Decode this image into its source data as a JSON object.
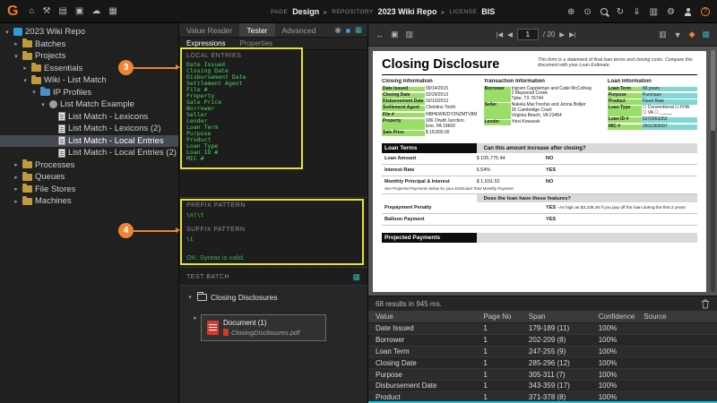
{
  "glyphs": {
    "chevron_down": "▾",
    "chevron_right": "▸",
    "separator": "▸"
  },
  "topbar": {
    "logo_text": "G",
    "left_icons": [
      {
        "name": "home-icon",
        "glyph": "⌂"
      },
      {
        "name": "tools-icon",
        "glyph": "⚒"
      },
      {
        "name": "batches-icon",
        "glyph": "▤"
      },
      {
        "name": "camera-icon",
        "glyph": "▣"
      },
      {
        "name": "clouds-icon",
        "glyph": "☁"
      },
      {
        "name": "stats-icon",
        "glyph": "▦"
      }
    ],
    "breadcrumb": {
      "page_label": "PAGE",
      "page_value": "Design",
      "repo_label": "REPOSITORY",
      "repo_value": "2023 Wiki Repo",
      "license_label": "LICENSE",
      "license_value": "BIS"
    },
    "right_icons": [
      {
        "name": "add-circle-icon",
        "glyph": "⊕"
      },
      {
        "name": "target-circle-icon",
        "glyph": "⊙"
      },
      {
        "name": "search-icon",
        "glyph": ""
      },
      {
        "name": "refresh-icon",
        "glyph": "↻"
      },
      {
        "name": "download-icon",
        "glyph": "⇓"
      },
      {
        "name": "columns-icon",
        "glyph": "▥"
      },
      {
        "name": "gear-icon",
        "glyph": "⚙"
      },
      {
        "name": "user-icon",
        "glyph": ""
      },
      {
        "name": "help-icon",
        "glyph": "?"
      }
    ]
  },
  "tree": {
    "items": [
      {
        "label": "2023 Wiki Repo",
        "level": 0,
        "arrow": "down",
        "icon": "repo"
      },
      {
        "label": "Batches",
        "level": 1,
        "arrow": "right",
        "icon": "folder"
      },
      {
        "label": "Projects",
        "level": 1,
        "arrow": "down",
        "icon": "folder"
      },
      {
        "label": "Essentials",
        "level": 2,
        "arrow": "right",
        "icon": "folder"
      },
      {
        "label": "Wiki - List Match",
        "level": 2,
        "arrow": "down",
        "icon": "folder"
      },
      {
        "label": "IP Profiles",
        "level": 3,
        "arrow": "down",
        "icon": "folder-blue"
      },
      {
        "label": "List Match Example",
        "level": 4,
        "arrow": "down",
        "icon": "gear"
      },
      {
        "label": "List Match - Lexicons",
        "level": 5,
        "arrow": null,
        "icon": "doc"
      },
      {
        "label": "List Match - Lexicons (2)",
        "level": 5,
        "arrow": null,
        "icon": "doc"
      },
      {
        "label": "List Match - Local Entries",
        "level": 5,
        "arrow": null,
        "icon": "doc",
        "selected": true
      },
      {
        "label": "List Match - Local Entries (2)",
        "level": 5,
        "arrow": null,
        "icon": "doc"
      },
      {
        "label": "Processes",
        "level": 1,
        "arrow": "right",
        "icon": "folder"
      },
      {
        "label": "Queues",
        "level": 1,
        "arrow": "right",
        "icon": "folder"
      },
      {
        "label": "File Stores",
        "level": 1,
        "arrow": "right",
        "icon": "folder"
      },
      {
        "label": "Machines",
        "level": 1,
        "arrow": "right",
        "icon": "folder"
      }
    ]
  },
  "middle": {
    "tabs": [
      {
        "label": "Value Reader",
        "active": false
      },
      {
        "label": "Tester",
        "active": true
      },
      {
        "label": "Advanced",
        "active": false
      }
    ],
    "tab_icons": [
      {
        "name": "eye-icon",
        "glyph": "◉"
      },
      {
        "name": "blue-panel-icon",
        "glyph": "■"
      },
      {
        "name": "grid-icon",
        "glyph": "▦"
      }
    ],
    "subtabs": [
      {
        "label": "Expressions",
        "active": true
      },
      {
        "label": "Properties",
        "active": false
      }
    ],
    "local_entries_label": "LOCAL ENTRIES",
    "entries": [
      "Date Issued",
      "Closing Date",
      "Disbursement Date",
      "Settlement Agent",
      "File #",
      "Property",
      "Sale Price",
      "Borrower",
      "Seller",
      "Lender",
      "Loan Term",
      "Purpose",
      "Product",
      "Loan Type",
      "Loan ID #",
      "MIC #"
    ],
    "prefix_label": "PREFIX PATTERN",
    "prefix_value": "\\n|\\t",
    "suffix_label": "SUFFIX PATTERN",
    "suffix_value": "\\t",
    "syntax_status": "OK: Syntax is valid.",
    "test_batch": {
      "header": "TEST BATCH",
      "folder_label": "Closing Disclosures",
      "document_label": "Document (1)",
      "file_name": "ClosingDisclosures.pdf"
    }
  },
  "callouts": [
    {
      "number": "3"
    },
    {
      "number": "4"
    }
  ],
  "viewer": {
    "left_icons": [
      {
        "name": "fit-width-icon",
        "glyph": "↔"
      },
      {
        "name": "pages-icon",
        "glyph": "▣"
      },
      {
        "name": "thumbnails-icon",
        "glyph": "▥"
      }
    ],
    "nav": {
      "first": "|◀",
      "prev": "◀",
      "page": "1",
      "total": "/ 20",
      "next": "▶",
      "last": "▶|"
    },
    "right_icons": [
      {
        "name": "layout-icon",
        "glyph": "▥"
      },
      {
        "name": "dropdown-icon",
        "glyph": "▼"
      },
      {
        "name": "highlight-icon",
        "glyph": "◆"
      },
      {
        "name": "grid-teal-icon",
        "glyph": "▦"
      }
    ]
  },
  "document": {
    "title": "Closing Disclosure",
    "intro": "This form is a statement of final loan terms and closing costs. Compare this document with your Loan Estimate.",
    "columns": [
      {
        "header": "Closing Information",
        "fields": [
          {
            "label": "Date Issued",
            "value": "09/14/2015",
            "label_hl": "green"
          },
          {
            "label": "Closing Date",
            "value": "02/29/2013",
            "label_hl": "green"
          },
          {
            "label": "Disbursement Date",
            "value": "02/10/2013",
            "label_hl": "green"
          },
          {
            "label": "Settlement Agent",
            "value": "Christine Tooth",
            "label_hl": "green"
          },
          {
            "label": "File #",
            "value": "NBHKWR/DY2NZMTV8M2",
            "label_hl": "green"
          },
          {
            "label": "Property",
            "value": "936 Orwitt Junction\nErie, PA 18600",
            "label_hl": "green"
          },
          {
            "label": "Sale Price",
            "value": "$ 18,800.00",
            "label_hl": "green"
          }
        ]
      },
      {
        "header": "Transaction Information",
        "fields": [
          {
            "label": "Borrower",
            "value": "Ingram Cappleman and Catie McCollvay\n2 Maywood Creek\nTpke, TX 76744",
            "label_hl": "green"
          },
          {
            "label": "Seller",
            "value": "Nakela MacTroohio and Jenna Bolljer\n26 Cambridge Court\nVirginia Beach, VA 23464",
            "label_hl": "green"
          },
          {
            "label": "Lender",
            "value": "Yoixi Kowacek",
            "label_hl": "green"
          }
        ]
      },
      {
        "header": "Loan Information",
        "fields": [
          {
            "label": "Loan Term",
            "value": "80 years",
            "label_hl": "green",
            "value_hl": "teal"
          },
          {
            "label": "Purpose",
            "value": "Purchase",
            "label_hl": "green",
            "value_hl": "teal"
          },
          {
            "label": "Product",
            "value": "Fixed Rate",
            "label_hl": "green",
            "value_hl": "teal"
          },
          {
            "label": "Loan Type",
            "value": "☐ Conventional  ☑ FHA\n☐ VA  ☐ _____",
            "label_hl": "green"
          },
          {
            "label": "Loan ID #",
            "value": "5370953352",
            "label_hl": "green",
            "value_hl": "teal"
          },
          {
            "label": "MIC #",
            "value": "3502369097",
            "label_hl": "green",
            "value_hl": "teal"
          }
        ]
      }
    ],
    "loan_terms": {
      "header_left": "Loan Terms",
      "header_right": "Can this amount increase after closing?",
      "rows": [
        {
          "label": "Loan Amount",
          "value": "$ 105,775.44",
          "answer": "NO"
        },
        {
          "label": "Interest Rate",
          "value": "6.54%",
          "answer": "YES"
        },
        {
          "label": "Monthly Principal & Interest",
          "value": "$ 1,691.52",
          "answer": "NO",
          "note": "See Projected Payments below for your Estimated Total Monthly Payment"
        }
      ],
      "features_header": "Does the loan have these features?",
      "feature_rows": [
        {
          "label": "Prepayment Penalty",
          "answer": "YES",
          "detail": "As high as $3,235.35 if you pay off the loan during the first 2 years"
        },
        {
          "label": "Balloon Payment",
          "answer": "YES"
        }
      ]
    },
    "projected_payments_label": "Projected Payments"
  },
  "results": {
    "status": "68 results in 945 ms.",
    "columns": [
      "Value",
      "Page No",
      "Span",
      "Confidence",
      "Source"
    ],
    "rows": [
      [
        "Date Issued",
        "1",
        "179-189 (11)",
        "100%",
        ""
      ],
      [
        "Borrower",
        "1",
        "202-209 (8)",
        "100%",
        ""
      ],
      [
        "Loan Term",
        "1",
        "247-255 (9)",
        "100%",
        ""
      ],
      [
        "Closing Date",
        "1",
        "285-296 (12)",
        "100%",
        ""
      ],
      [
        "Purpose",
        "1",
        "305-311 (7)",
        "100%",
        ""
      ],
      [
        "Disbursement Date",
        "1",
        "343-359 (17)",
        "100%",
        ""
      ],
      [
        "Product",
        "1",
        "371-378 (8)",
        "100%",
        ""
      ]
    ]
  }
}
